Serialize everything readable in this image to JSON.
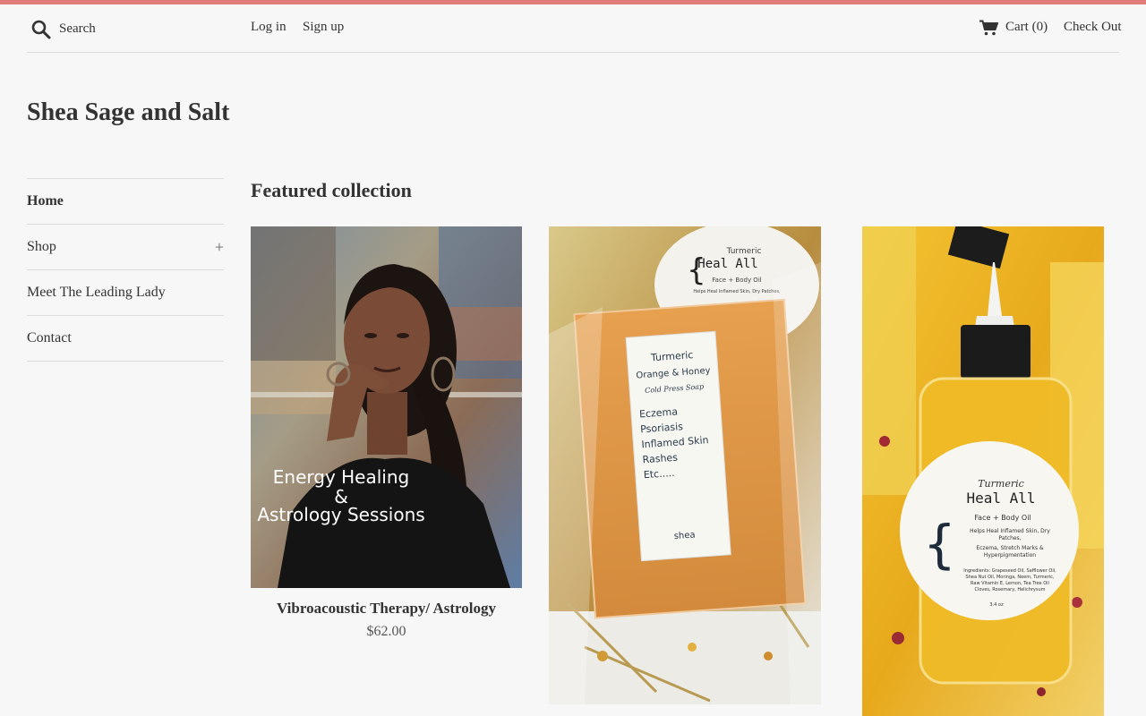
{
  "colors": {
    "accent": "#e07c79",
    "text": "#333333",
    "background": "#f7f7f7",
    "divider": "#dcdcdc"
  },
  "header": {
    "search_placeholder": "Search",
    "search_icon": "search-icon",
    "login_label": "Log in",
    "signup_label": "Sign up",
    "cart_icon": "cart-icon",
    "cart_label": "Cart (0)",
    "checkout_label": "Check Out"
  },
  "site": {
    "title": "Shea Sage and Salt"
  },
  "sidebar": {
    "items": [
      {
        "label": "Home",
        "active": true
      },
      {
        "label": "Shop",
        "expand_icon": "+"
      },
      {
        "label": "Meet The Leading Lady"
      },
      {
        "label": "Contact"
      }
    ]
  },
  "main": {
    "section_title": "Featured collection",
    "products": [
      {
        "image_text_line1": "Energy Healing",
        "image_text_line2": "&",
        "image_text_line3": "Astrology Sessions",
        "name": "Vibroacoustic Therapy/ Astrology",
        "price": "$62.00"
      },
      {
        "label_line1": "Turmeric",
        "label_line2": "Orange & Honey",
        "label_line3": "Cold Press Soap",
        "label_list": [
          "Eczema",
          "Psoriasis",
          "Inflamed Skin",
          "Rashes",
          "Etc....."
        ],
        "label_brand": "shea",
        "jar_line1": "Turmeric",
        "jar_line2": "Heal All",
        "jar_line3": "Face + Body Oil",
        "jar_line4": "Helps Heal Inflamed Skin, Dry Patches,"
      },
      {
        "label_line1": "Turmeric",
        "label_line2": "Heal All",
        "label_line3": "Face + Body Oil",
        "label_line4": "Helps Heal Inflamed Skin, Dry",
        "label_line5": "Patches,",
        "label_line6": "Eczema, Stretch Marks &",
        "label_line7": "Hyperpigmentation",
        "label_line8": "Ingredients: Grapeseed Oil, Safflower Oil,",
        "label_line9": "Shea Nut Oil, Moringa, Neem, Turmeric,",
        "label_line10": "Raw Vitamin E, Lemon, Tea Tree Oil",
        "label_line11": "Cloves, Rosemary, Helichrysum",
        "label_size": "3.4 oz"
      }
    ]
  }
}
